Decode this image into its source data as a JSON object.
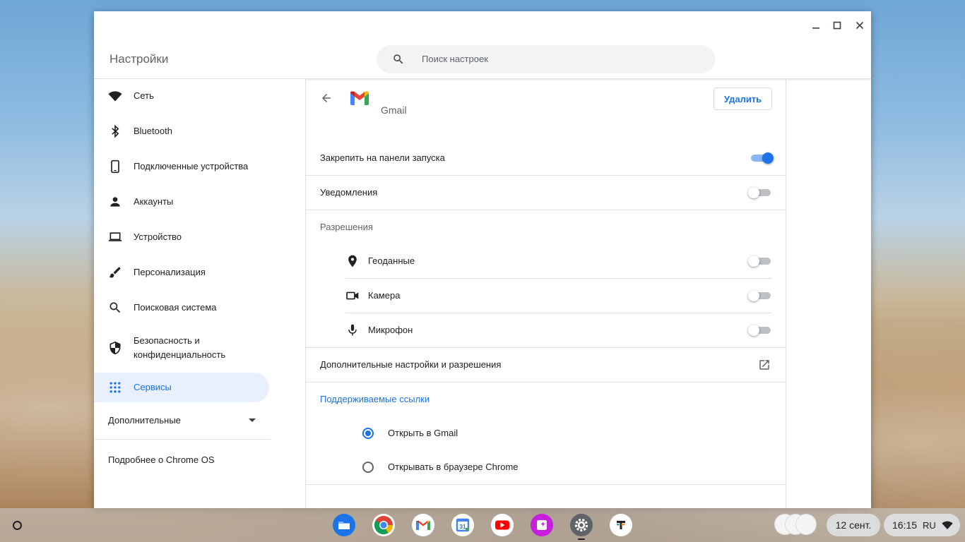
{
  "window": {
    "title": "Настройки",
    "search_placeholder": "Поиск настроек"
  },
  "sidebar": {
    "items": [
      {
        "label": "Сеть",
        "icon": "wifi-icon"
      },
      {
        "label": "Bluetooth",
        "icon": "bluetooth-icon"
      },
      {
        "label": "Подключенные устройства",
        "icon": "phone-icon"
      },
      {
        "label": "Аккаунты",
        "icon": "person-icon"
      },
      {
        "label": "Устройство",
        "icon": "laptop-icon"
      },
      {
        "label": "Персонализация",
        "icon": "brush-icon"
      },
      {
        "label": "Поисковая система",
        "icon": "search-icon"
      },
      {
        "label": "Безопасность и",
        "label2": "конфиденциальность",
        "icon": "shield-icon"
      },
      {
        "label": "Сервисы",
        "icon": "apps-grid-icon",
        "active": true
      }
    ],
    "advanced_label": "Дополнительные",
    "about_label": "Подробнее о Chrome OS"
  },
  "app_detail": {
    "app_name": "Gmail",
    "uninstall_label": "Удалить",
    "pin_label": "Закрепить на панели запуска",
    "pin_enabled": true,
    "notifications_label": "Уведомления",
    "notifications_enabled": false,
    "permissions_header": "Разрешения",
    "permissions": [
      {
        "label": "Геоданные",
        "icon": "location-icon",
        "enabled": false
      },
      {
        "label": "Камера",
        "icon": "camera-icon",
        "enabled": false
      },
      {
        "label": "Микрофон",
        "icon": "microphone-icon",
        "enabled": false
      }
    ],
    "more_settings_label": "Дополнительные настройки и разрешения",
    "supported_links_header": "Поддерживаемые ссылки",
    "link_options": [
      {
        "label": "Открыть в Gmail",
        "selected": true
      },
      {
        "label": "Открывать в браузере Chrome",
        "selected": false
      }
    ]
  },
  "shelf": {
    "apps": [
      "files",
      "chrome",
      "gmail",
      "calendar",
      "youtube",
      "canvas",
      "settings",
      "tasks"
    ],
    "date_label": "12 сент.",
    "time_label": "16:15",
    "keyboard_layout": "RU"
  },
  "colors": {
    "accent": "#1a73e8",
    "accent_light": "#8ab4f8",
    "active_bg": "#e8f0fe"
  }
}
